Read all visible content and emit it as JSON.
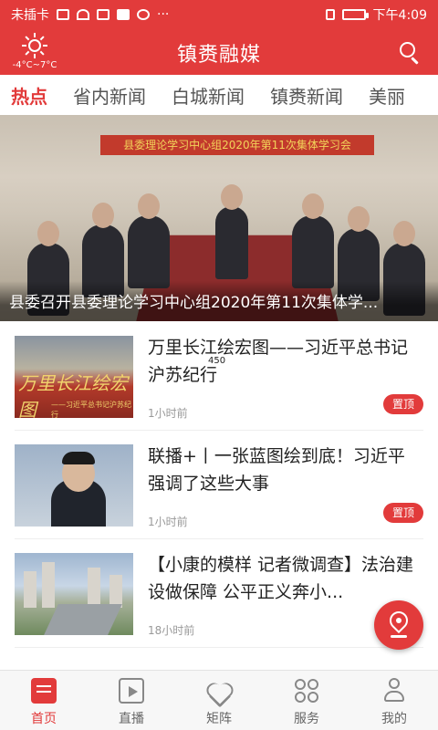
{
  "status_bar": {
    "carrier": "未插卡",
    "time": "下午4:09",
    "more": "···"
  },
  "header": {
    "title": "镇赉融媒",
    "weather": {
      "icon": "sun-icon",
      "temperature": "-4°C~7°C"
    },
    "search_icon": "search-icon"
  },
  "tabs": [
    {
      "label": "热点",
      "active": true
    },
    {
      "label": "省内新闻"
    },
    {
      "label": "白城新闻"
    },
    {
      "label": "镇赉新闻"
    },
    {
      "label": "美丽"
    }
  ],
  "hero": {
    "banner": "县委理论学习中心组2020年第11次集体学习会",
    "caption": "县委召开县委理论学习中心组2020年第11次集体学..."
  },
  "news": [
    {
      "title": "万里长江绘宏图——习近平总书记沪苏纪行",
      "time": "1小时前",
      "badge": "置顶",
      "thumb_text": "万里长江绘宏图",
      "thumb_subtext": "——习近平总书记沪苏纪行"
    },
    {
      "title": "联播+丨一张蓝图绘到底！习近平强调了这些大事",
      "time": "1小时前",
      "badge": "置顶"
    },
    {
      "title": "【小康的模样 记者微调查】法治建设做保障 公平正义奔小...",
      "time": "18小时前"
    }
  ],
  "view_count": "450",
  "fab_icon": "location-pin-icon",
  "bottom_nav": [
    {
      "label": "首页",
      "icon": "home-icon",
      "active": true
    },
    {
      "label": "直播",
      "icon": "live-video-icon"
    },
    {
      "label": "矩阵",
      "icon": "heart-icon"
    },
    {
      "label": "服务",
      "icon": "grid-icon"
    },
    {
      "label": "我的",
      "icon": "user-icon"
    }
  ],
  "colors": {
    "brand": "#e23b3b"
  }
}
